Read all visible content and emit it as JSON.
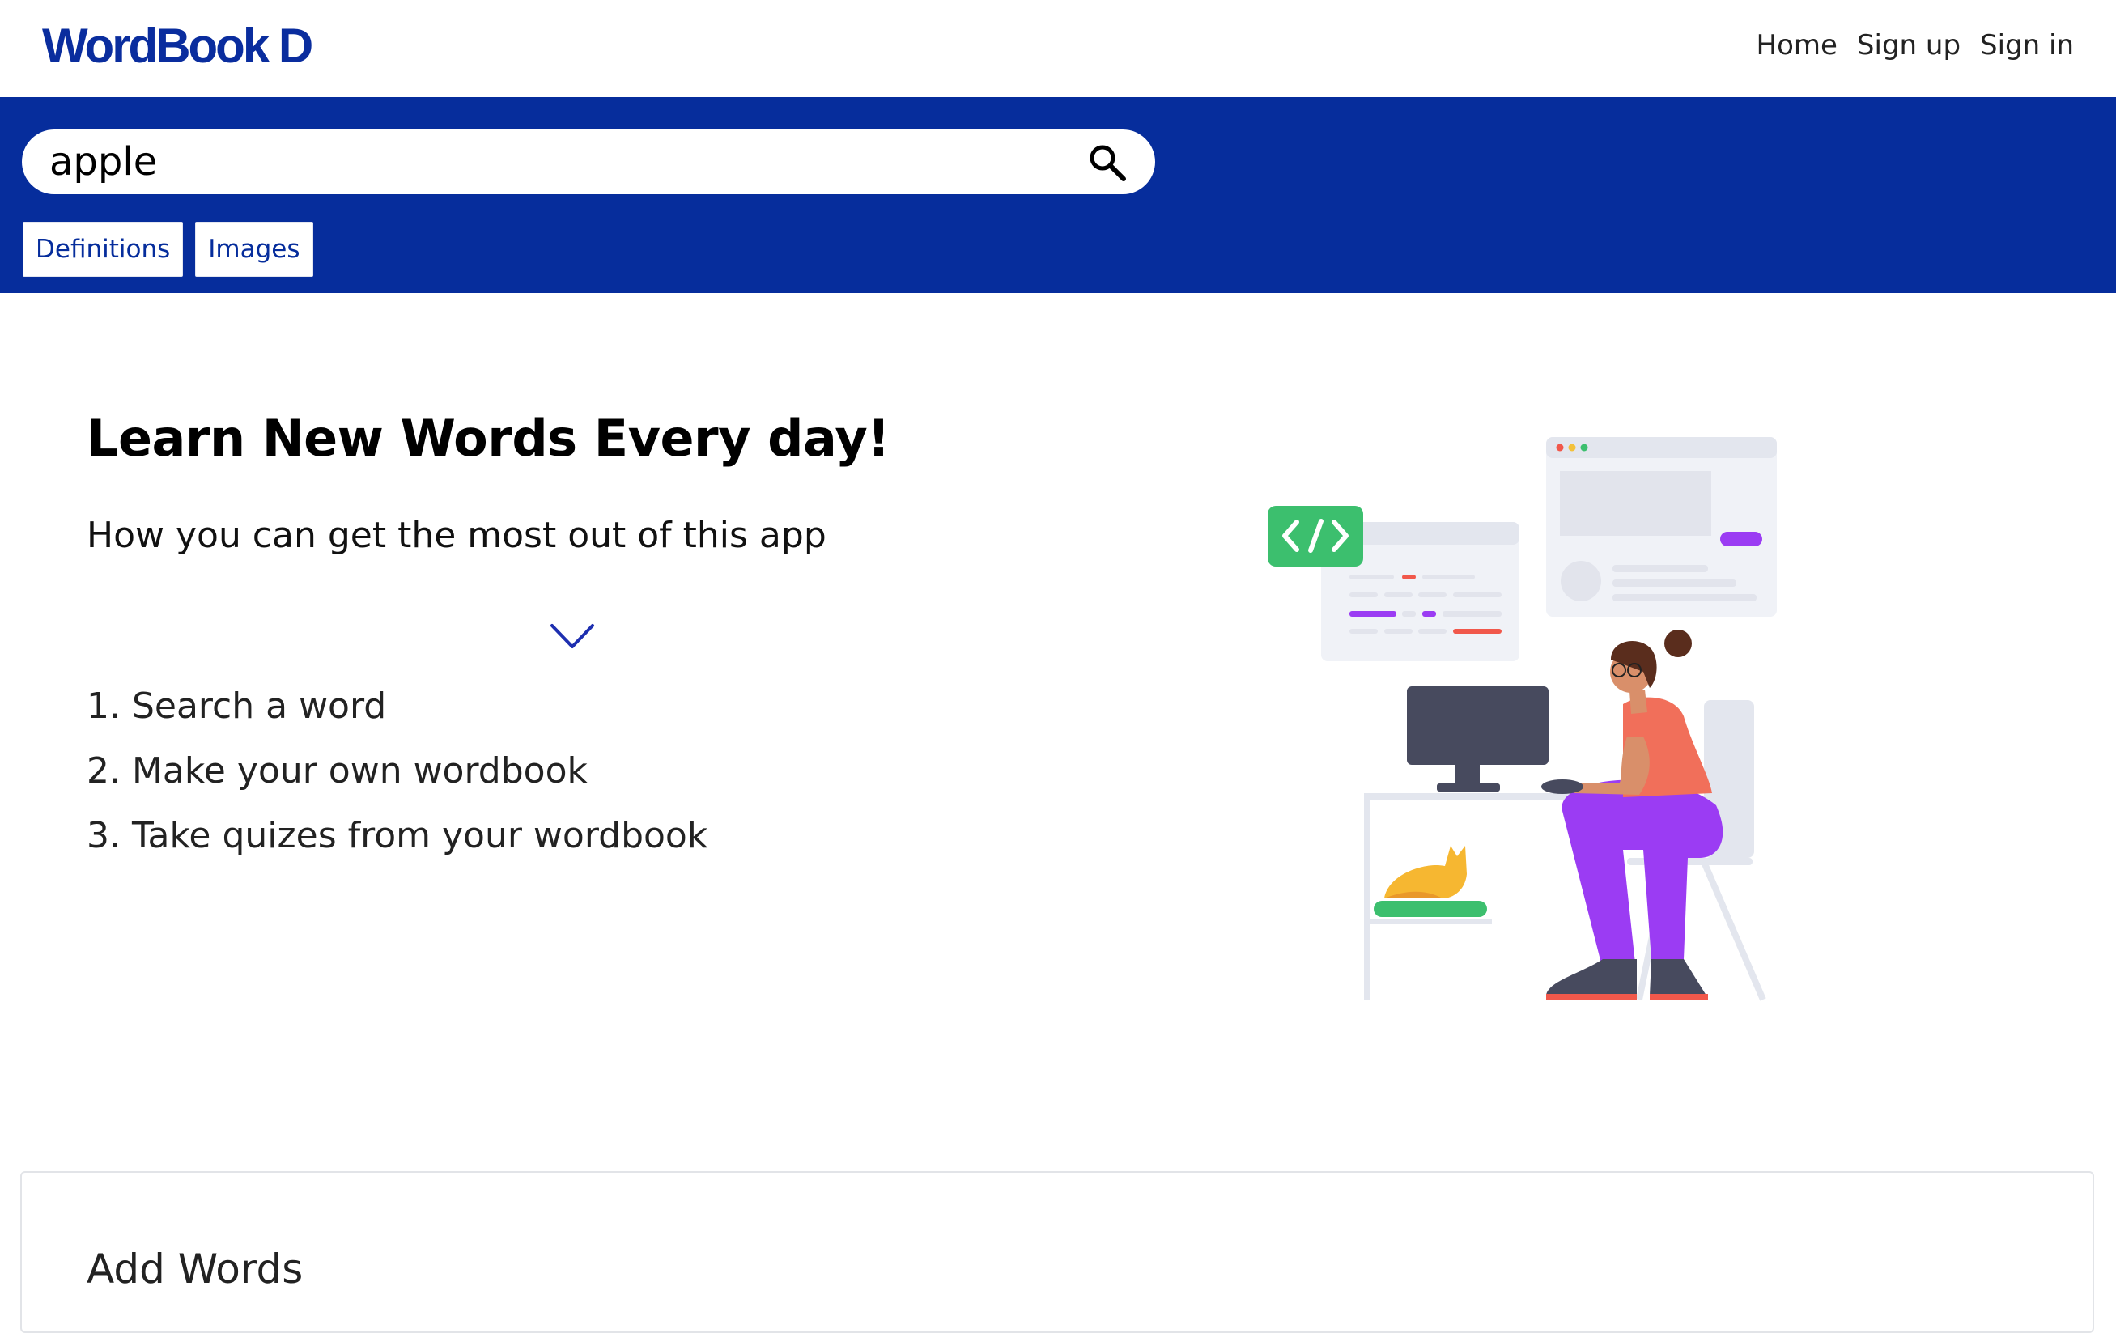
{
  "brand": {
    "logo_text": "WordBook D",
    "color": "#0a2d9e"
  },
  "nav": {
    "home": "Home",
    "sign_up": "Sign up",
    "sign_in": "Sign in"
  },
  "search": {
    "value": "apple",
    "icon": "search-icon"
  },
  "tabs": [
    {
      "label": "Definitions"
    },
    {
      "label": "Images"
    }
  ],
  "theme": {
    "band_color": "#062d9c"
  },
  "hero": {
    "title": "Learn New Words Every day!",
    "subtitle": "How you can get the most out of this app",
    "expand_icon": "chevron-down-icon",
    "steps": [
      "1. Search a word",
      "2. Make your own wordbook",
      "3. Take quizes from your wordbook"
    ],
    "illustration": "woman-at-computer-illustration"
  },
  "add_words": {
    "title": "Add Words"
  }
}
